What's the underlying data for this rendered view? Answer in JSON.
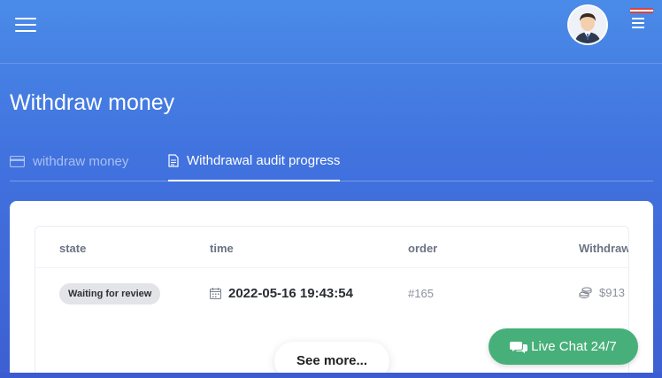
{
  "header": {
    "menu_icon": "hamburger-icon",
    "avatar_icon": "user-avatar",
    "right_menu_icon": "menu-icon"
  },
  "page": {
    "title": "Withdraw money"
  },
  "tabs": [
    {
      "label": "withdraw money",
      "icon": "card-icon",
      "active": false
    },
    {
      "label": "Withdrawal audit progress",
      "icon": "document-icon",
      "active": true
    }
  ],
  "table": {
    "columns": [
      "state",
      "time",
      "order",
      "Withdraw"
    ],
    "rows": [
      {
        "state": "Waiting for review",
        "time": "2022-05-16 19:43:54",
        "order": "#165",
        "amount": "$913"
      }
    ]
  },
  "see_more_label": "See more...",
  "live_chat_label": "Live Chat 24/7",
  "colors": {
    "background_top": "#4a8be8",
    "background_bottom": "#3d5fd2",
    "live_chat": "#47b07a",
    "badge_bg": "#e2e4e8"
  }
}
